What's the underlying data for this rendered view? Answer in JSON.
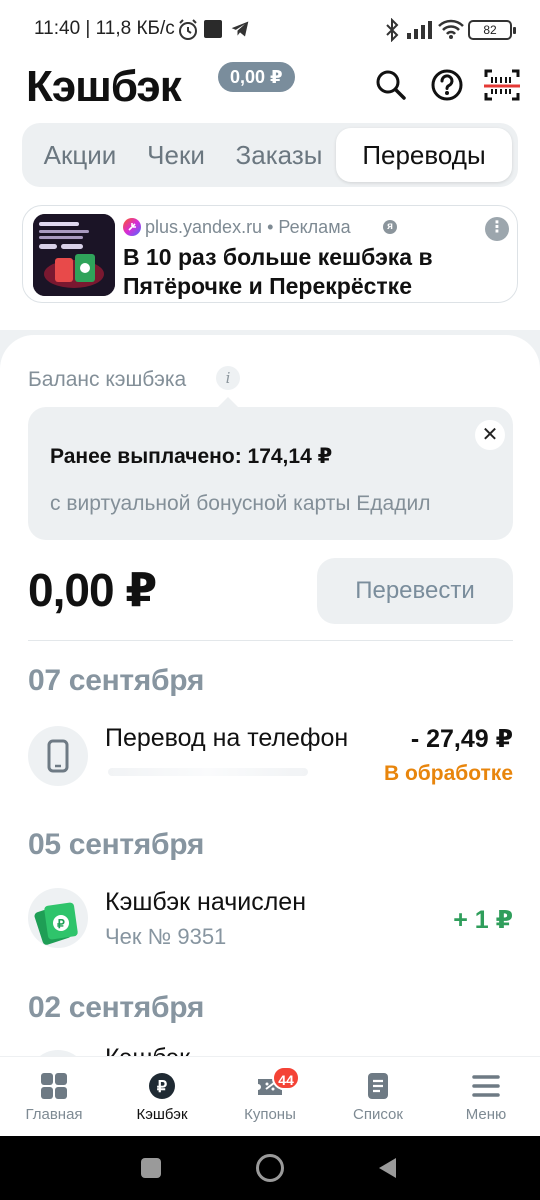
{
  "status_bar": {
    "time": "11:40 | 11,8 КБ/с",
    "battery": "82"
  },
  "header": {
    "title": "Кэшбэк",
    "balance_pill": "0,00 ₽"
  },
  "tabs": [
    {
      "label": "Акции"
    },
    {
      "label": "Чеки"
    },
    {
      "label": "Заказы"
    },
    {
      "label": "Переводы",
      "active": true
    }
  ],
  "ad": {
    "source": "plus.yandex.ru • Реклама",
    "text": "В 10 раз больше кешбэка в Пятёрочке и Перекрёстке"
  },
  "balance": {
    "label": "Баланс кэшбэка",
    "tooltip_title": "Ранее выплачено: 174,14 ₽",
    "tooltip_subtitle": "с виртуальной бонусной карты Едадил",
    "amount": "0,00 ₽",
    "transfer_button": "Перевести"
  },
  "history": [
    {
      "date": "07 сентября",
      "title": "Перевод на телефон",
      "amount": "- 27,49 ₽",
      "status": "В обработке"
    },
    {
      "date": "05 сентября",
      "title": "Кэшбэк начислен",
      "subtitle": "Чек № 9351",
      "amount": "+ 1 ₽"
    },
    {
      "date": "02 сентября",
      "title": "Кэшбэк"
    }
  ],
  "bottom_nav": [
    {
      "label": "Главная"
    },
    {
      "label": "Кэшбэк",
      "active": true
    },
    {
      "label": "Купоны",
      "badge": "44"
    },
    {
      "label": "Список"
    },
    {
      "label": "Меню"
    }
  ],
  "colors": {
    "accent_orange": "#e8850c",
    "positive_green": "#2f9e5b",
    "muted_gray": "#8795a0"
  }
}
